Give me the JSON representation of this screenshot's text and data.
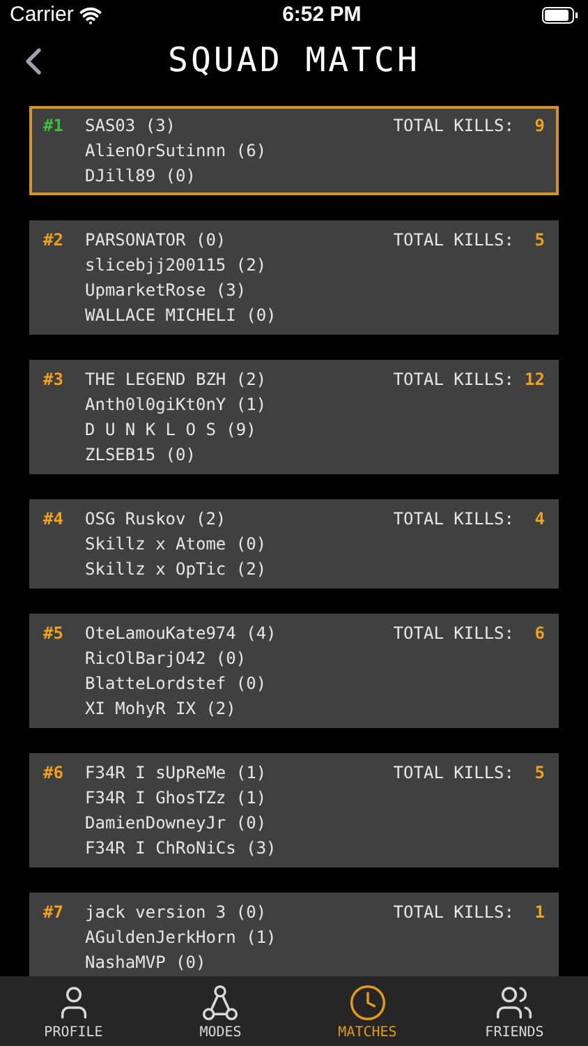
{
  "status_bar": {
    "carrier": "Carrier",
    "time": "6:52 PM"
  },
  "header": {
    "title": "SQUAD MATCH"
  },
  "squads": [
    {
      "rank": "#1",
      "selected": true,
      "color": "#3fbf3f",
      "kills_label": "TOTAL KILLS:",
      "kills": "9",
      "players": [
        "SAS03 (3)",
        "AlienOrSutinnn (6)",
        "DJill89 (0)"
      ]
    },
    {
      "rank": "#2",
      "selected": false,
      "color": "#f0a020",
      "kills_label": "TOTAL KILLS:",
      "kills": "5",
      "players": [
        "PARSONATOR (0)",
        "slicebjj200115 (2)",
        "UpmarketRose (3)",
        "WALLACE MICHELI (0)"
      ]
    },
    {
      "rank": "#3",
      "selected": false,
      "color": "#f0a020",
      "kills_label": "TOTAL KILLS:",
      "kills": "12",
      "players": [
        "THE LEGEND BZH (2)",
        "Anth0l0giKt0nY (1)",
        "D U N K L O S (9)",
        "ZLSEB15 (0)"
      ]
    },
    {
      "rank": "#4",
      "selected": false,
      "color": "#f0a020",
      "kills_label": "TOTAL KILLS:",
      "kills": "4",
      "players": [
        "OSG Ruskov (2)",
        "Skillz x Atome (0)",
        "Skillz x OpTic (2)"
      ]
    },
    {
      "rank": "#5",
      "selected": false,
      "color": "#f0a020",
      "kills_label": "TOTAL KILLS:",
      "kills": "6",
      "players": [
        "OteLamouKate974 (4)",
        "RicOlBarjO42 (0)",
        "BlatteLordstef (0)",
        "XI MohyR IX (2)"
      ]
    },
    {
      "rank": "#6",
      "selected": false,
      "color": "#f0a020",
      "kills_label": "TOTAL KILLS:",
      "kills": "5",
      "players": [
        "F34R I sUpReMe (1)",
        "F34R I GhosTZz (1)",
        "DamienDowneyJr (0)",
        "F34R I ChRoNiCs (3)"
      ]
    },
    {
      "rank": "#7",
      "selected": false,
      "color": "#f0a020",
      "kills_label": "TOTAL KILLS:",
      "kills": "1",
      "players": [
        "jack version 3 (0)",
        "AGuldenJerkHorn (1)",
        "NashaMVP (0)"
      ]
    }
  ],
  "tab_bar": [
    {
      "kind": "profile",
      "label": "PROFILE",
      "selected": false
    },
    {
      "kind": "modes",
      "label": "MODES",
      "selected": false
    },
    {
      "kind": "matches",
      "label": "MATCHES",
      "selected": true
    },
    {
      "kind": "friends",
      "label": "FRIENDS",
      "selected": false
    }
  ]
}
